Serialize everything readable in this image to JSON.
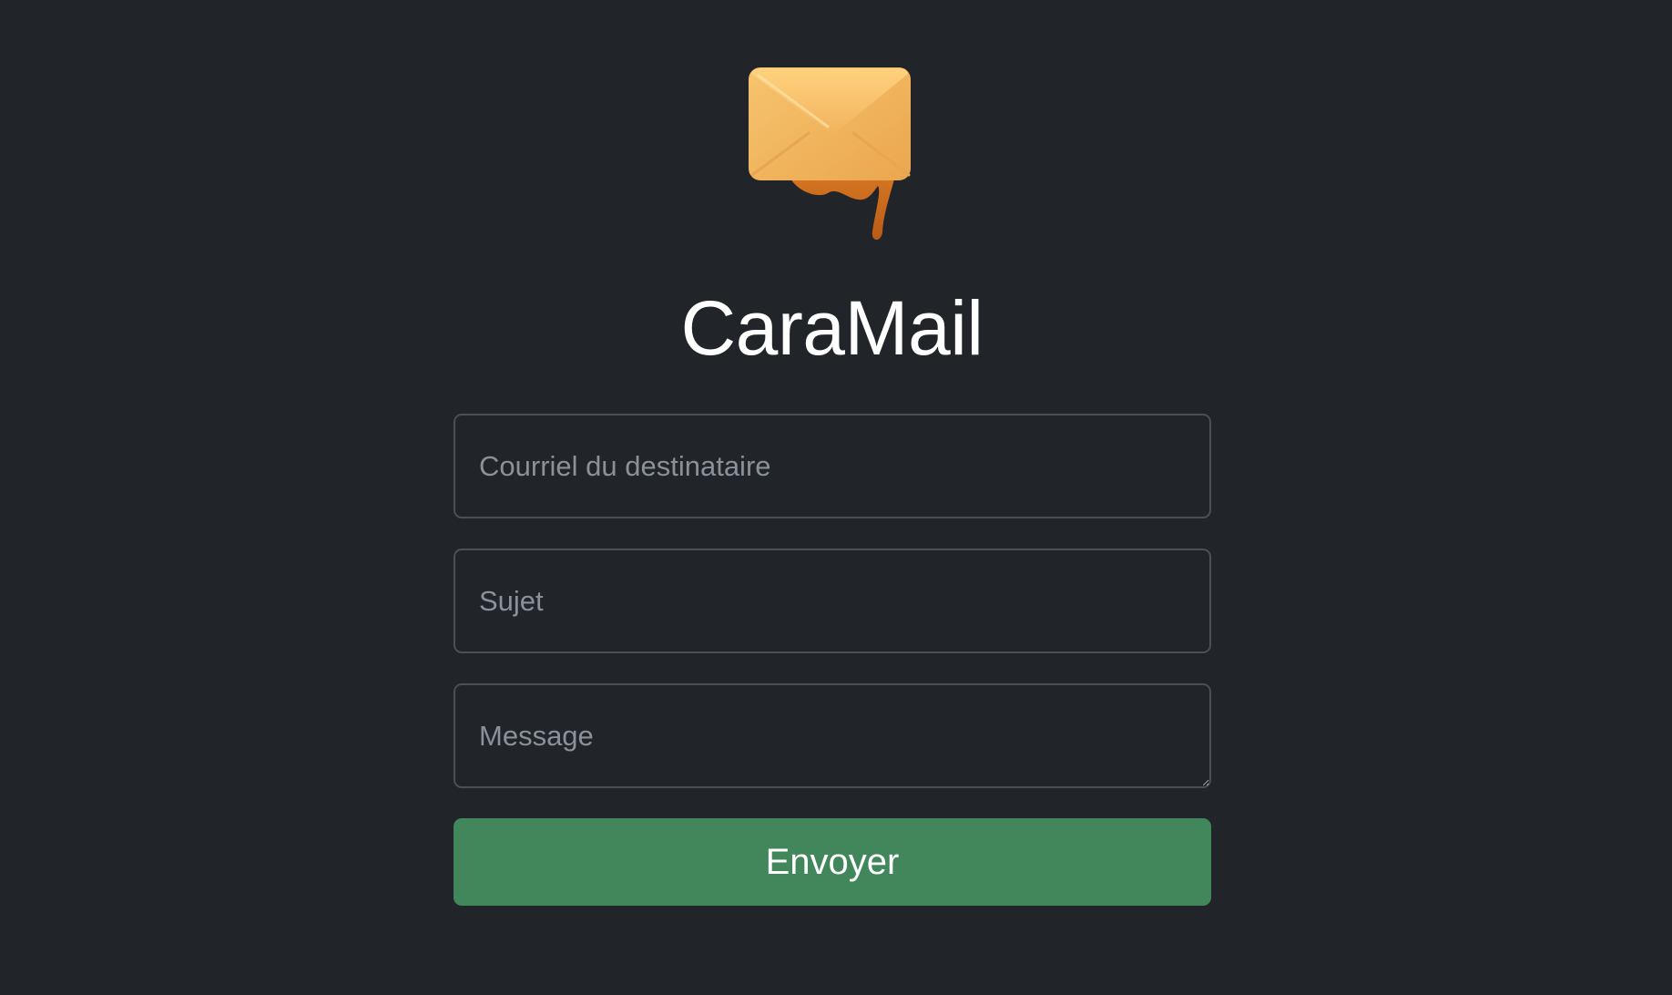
{
  "app": {
    "title": "CaraMail",
    "logo_icon": "caramel-dripping-envelope-icon"
  },
  "form": {
    "recipient_placeholder": "Courriel du destinataire",
    "recipient_value": "",
    "subject_placeholder": "Sujet",
    "subject_value": "",
    "message_placeholder": "Message",
    "message_value": "",
    "send_label": "Envoyer"
  },
  "colors": {
    "background": "#212529",
    "field_border": "#495057",
    "placeholder": "#8b9198",
    "button": "#41875b",
    "envelope": "#f2b15a",
    "caramel": "#c96a21"
  }
}
